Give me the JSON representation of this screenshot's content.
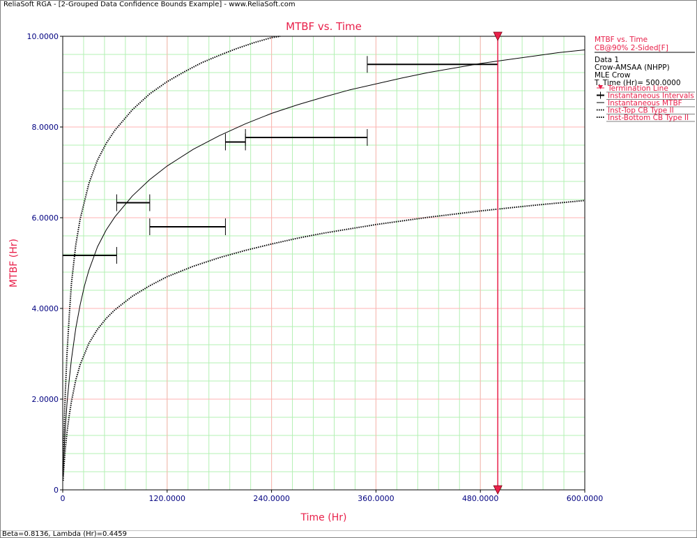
{
  "window": {
    "title": "ReliaSoft RGA - [2-Grouped Data Confidence Bounds Example] - www.ReliaSoft.com"
  },
  "status": {
    "text": "Beta=0.8136, Lambda (Hr)=0.4459"
  },
  "legend": {
    "plot_name": "MTBF vs. Time",
    "cb_label": "CB@90% 2-Sided[F]",
    "data_name": "Data 1",
    "model": "Crow-AMSAA (NHPP)",
    "method": "MLE Crow",
    "ttime": "T. Time (Hr)= 500.0000",
    "items": [
      {
        "label": "Termination Line",
        "style": "termination",
        "color": "#e8204a"
      },
      {
        "label": "Instantaneous Intervals",
        "style": "intervals",
        "color": "#000000"
      },
      {
        "label": "Instantaneous MTBF",
        "style": "solid",
        "color": "#000000"
      },
      {
        "label": "Inst-Top CB Type II",
        "style": "dotted",
        "color": "#000000"
      },
      {
        "label": "Inst-Bottom CB Type II",
        "style": "dotted",
        "color": "#000000"
      }
    ]
  },
  "chart_data": {
    "type": "line",
    "title": "MTBF vs. Time",
    "xlabel": "Time (Hr)",
    "ylabel": "MTBF (Hr)",
    "xlim": [
      0,
      600
    ],
    "ylim": [
      0,
      10
    ],
    "x_ticks": [
      0,
      120,
      240,
      360,
      480,
      600
    ],
    "x_tick_labels": [
      "0",
      "120.0000",
      "240.0000",
      "360.0000",
      "480.0000",
      "600.0000"
    ],
    "y_ticks": [
      0,
      2,
      4,
      6,
      8,
      10
    ],
    "y_tick_labels": [
      "0",
      "2.0000",
      "4.0000",
      "6.0000",
      "8.0000",
      "10.0000"
    ],
    "grid": true,
    "minor_grid": true,
    "colors": {
      "title": "#e8204a",
      "axis_title": "#e8204a",
      "tick": "#000080",
      "major_grid": "#ffb3b3",
      "minor_grid": "#b3f0b3",
      "termination": "#e8204a",
      "curve": "#000000"
    },
    "termination_time": 500,
    "series": [
      {
        "name": "Instantaneous MTBF",
        "style": "solid",
        "x": [
          0.5,
          1,
          2,
          3,
          5,
          7.5,
          10,
          15,
          20,
          25,
          30,
          40,
          50,
          60,
          80,
          100,
          120,
          150,
          180,
          210,
          240,
          270,
          300,
          330,
          360,
          390,
          420,
          450,
          480,
          510,
          540,
          570,
          600
        ],
        "y": [
          0.31,
          0.61,
          1.02,
          1.37,
          1.92,
          2.44,
          2.88,
          3.56,
          4.08,
          4.5,
          4.84,
          5.36,
          5.73,
          6.02,
          6.48,
          6.84,
          7.14,
          7.51,
          7.81,
          8.07,
          8.3,
          8.49,
          8.66,
          8.82,
          8.95,
          9.08,
          9.2,
          9.3,
          9.4,
          9.48,
          9.56,
          9.64,
          9.7
        ]
      },
      {
        "name": "Inst-Top CB Type II",
        "style": "dotted",
        "x": [
          0.5,
          1,
          2,
          3,
          5,
          7.5,
          10,
          15,
          20,
          30,
          40,
          50,
          60,
          80,
          100,
          120,
          140,
          160,
          180,
          200,
          220,
          240,
          250
        ],
        "y": [
          0.48,
          0.95,
          1.6,
          2.15,
          3.02,
          3.85,
          4.55,
          5.4,
          5.97,
          6.75,
          7.27,
          7.64,
          7.93,
          8.38,
          8.73,
          9.0,
          9.22,
          9.42,
          9.58,
          9.73,
          9.86,
          9.97,
          10.0
        ]
      },
      {
        "name": "Inst-Bottom CB Type II",
        "style": "dotted",
        "x": [
          0.5,
          1,
          2,
          3,
          5,
          7.5,
          10,
          15,
          20,
          30,
          40,
          50,
          60,
          80,
          100,
          120,
          150,
          180,
          210,
          240,
          270,
          300,
          360,
          420,
          480,
          540,
          600
        ],
        "y": [
          0.2,
          0.39,
          0.67,
          0.9,
          1.28,
          1.65,
          1.95,
          2.42,
          2.76,
          3.23,
          3.54,
          3.78,
          3.97,
          4.27,
          4.5,
          4.7,
          4.93,
          5.12,
          5.28,
          5.42,
          5.55,
          5.66,
          5.85,
          6.01,
          6.15,
          6.27,
          6.38
        ]
      }
    ],
    "intervals": [
      {
        "x_start": 0,
        "x_end": 62,
        "mtbf": 5.17
      },
      {
        "x_start": 62,
        "x_end": 100,
        "mtbf": 6.33
      },
      {
        "x_start": 100,
        "x_end": 187,
        "mtbf": 5.8
      },
      {
        "x_start": 187,
        "x_end": 210,
        "mtbf": 7.67
      },
      {
        "x_start": 210,
        "x_end": 350,
        "mtbf": 7.77
      },
      {
        "x_start": 350,
        "x_end": 500,
        "mtbf": 9.38
      }
    ]
  }
}
